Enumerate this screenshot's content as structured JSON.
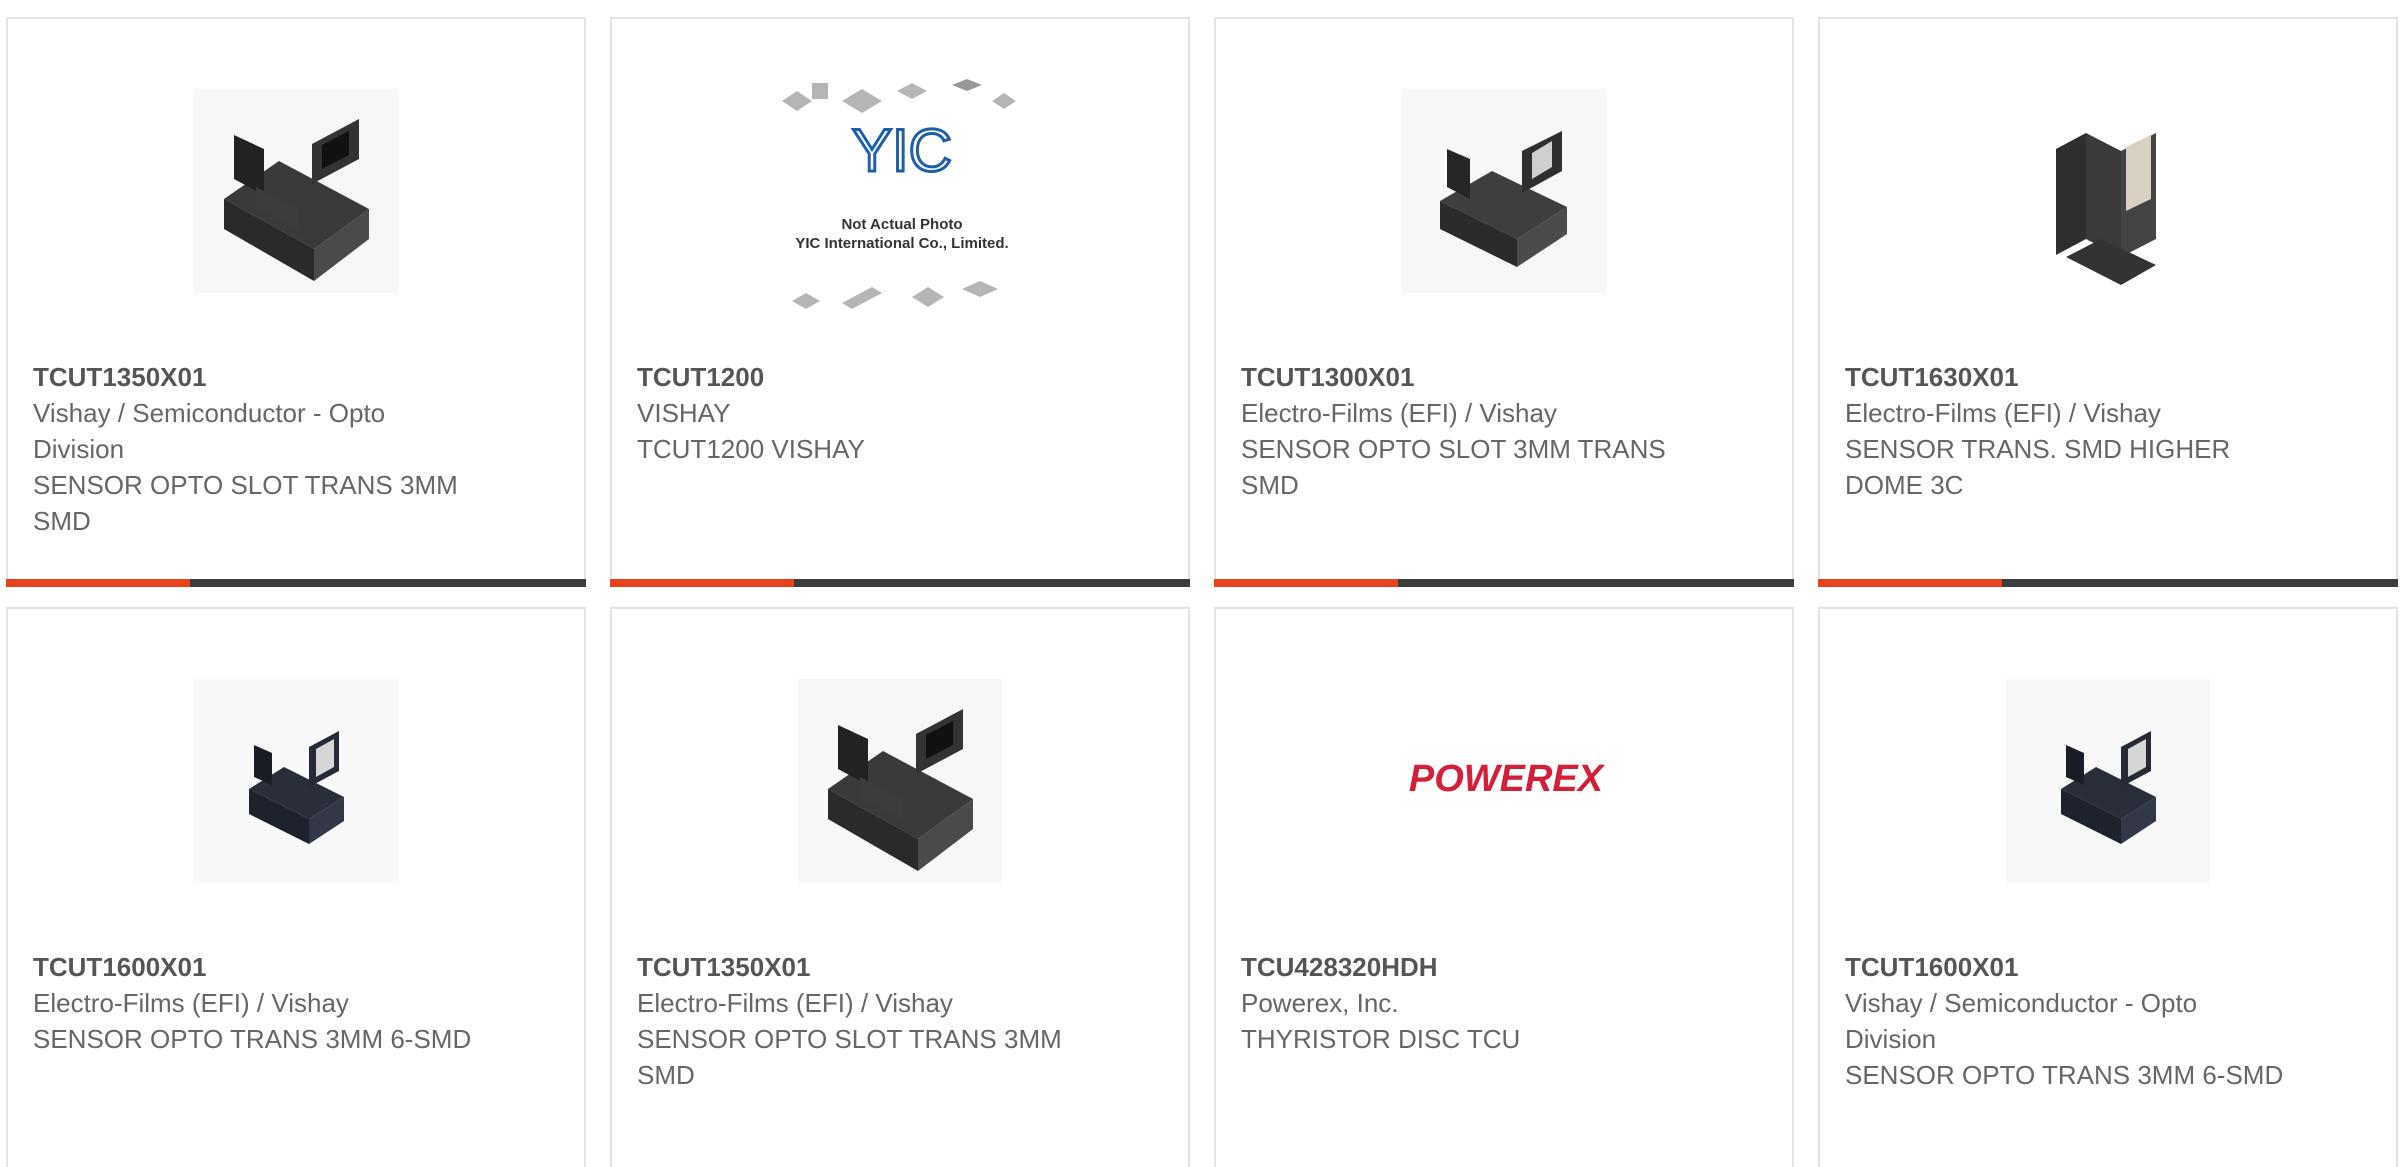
{
  "colors": {
    "accent": "#e8431f",
    "bar_dark": "#3d3d3d",
    "powerex_red": "#d41f3a",
    "yic_blue": "#1f5fa8"
  },
  "products": [
    {
      "part": "TCUT1350X01",
      "manufacturer": "Vishay / Semiconductor - Opto Division",
      "description": "SENSOR OPTO SLOT TRANS 3MM SMD",
      "image": "sensor-photo"
    },
    {
      "part": "TCUT1200",
      "manufacturer": "VISHAY",
      "description": "TCUT1200 VISHAY",
      "image": "yic-placeholder",
      "image_text": {
        "logo": "YIC",
        "line1": "Not Actual Photo",
        "line2": "YIC International Co., Limited."
      }
    },
    {
      "part": "TCUT1300X01",
      "manufacturer": "Electro-Films (EFI) / Vishay",
      "description": "SENSOR OPTO SLOT 3MM TRANS SMD",
      "image": "sensor-photo"
    },
    {
      "part": "TCUT1630X01",
      "manufacturer": "Electro-Films (EFI) / Vishay",
      "description": "SENSOR TRANS. SMD HIGHER DOME 3C",
      "image": "sensor-photo"
    },
    {
      "part": "TCUT1600X01",
      "manufacturer": "Electro-Films (EFI) / Vishay",
      "description": "SENSOR OPTO TRANS 3MM 6-SMD",
      "image": "sensor-photo"
    },
    {
      "part": "TCUT1350X01",
      "manufacturer": "Electro-Films (EFI) / Vishay",
      "description": "SENSOR OPTO SLOT TRANS 3MM SMD",
      "image": "sensor-photo"
    },
    {
      "part": "TCU428320HDH",
      "manufacturer": "Powerex, Inc.",
      "description": "THYRISTOR DISC TCU",
      "image": "powerex-logo",
      "image_text": {
        "logo": "POWEREX"
      }
    },
    {
      "part": "TCUT1600X01",
      "manufacturer": "Vishay / Semiconductor - Opto Division",
      "description": "SENSOR OPTO TRANS 3MM 6-SMD",
      "image": "sensor-photo"
    }
  ]
}
